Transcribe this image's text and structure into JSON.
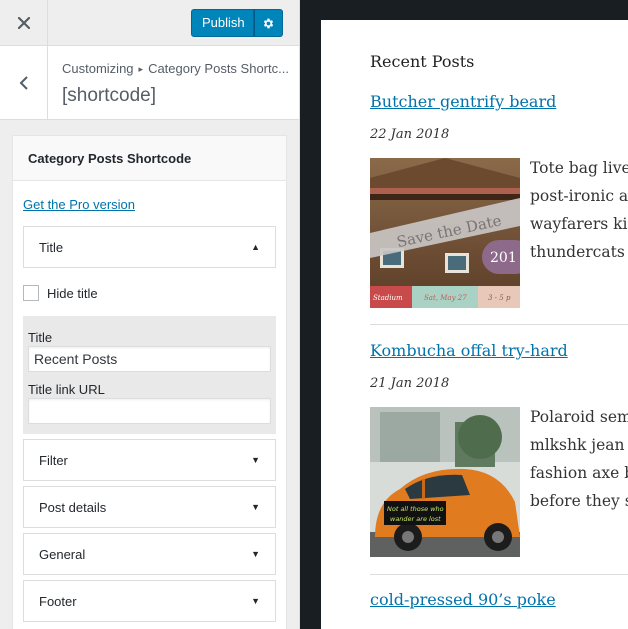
{
  "header": {
    "publish_label": "Publish",
    "close_icon": "close-icon",
    "settings_icon": "gear-icon"
  },
  "section": {
    "crumb_root": "Customizing",
    "crumb_child": "Category Posts Shortc...",
    "title": "[shortcode]"
  },
  "widget": {
    "title": "Category Posts Shortcode",
    "pro_link": "Get the Pro version",
    "title_section": "Title",
    "hide_title_label": "Hide title",
    "title_field_label": "Title",
    "title_field_value": "Recent Posts",
    "title_link_label": "Title link URL",
    "title_link_value": "",
    "sections": [
      "Filter",
      "Post details",
      "General",
      "Footer"
    ]
  },
  "preview": {
    "heading": "Recent Posts",
    "posts": [
      {
        "title": "Butcher gentrify beard",
        "date": "22 Jan 2018",
        "excerpt": [
          "Tote bag live",
          "post-ironic a",
          "wayfarers kic",
          "thundercats"
        ],
        "thumb_text": [
          "Save the Date",
          "201",
          "Stadium",
          "Sat, May 27",
          "3 - 5 p"
        ]
      },
      {
        "title": "Kombucha offal try-hard",
        "date": "21 Jan 2018",
        "excerpt": [
          "Polaroid sem",
          "mlkshk jean",
          "fashion axe b",
          "before they s"
        ],
        "thumb_text": [
          "Not all those who",
          "wander are lost"
        ]
      },
      {
        "title": "cold-pressed 90’s poke"
      }
    ]
  },
  "colors": {
    "accent": "#0085ba",
    "link": "#0073aa",
    "dark_bg": "#191e23"
  }
}
